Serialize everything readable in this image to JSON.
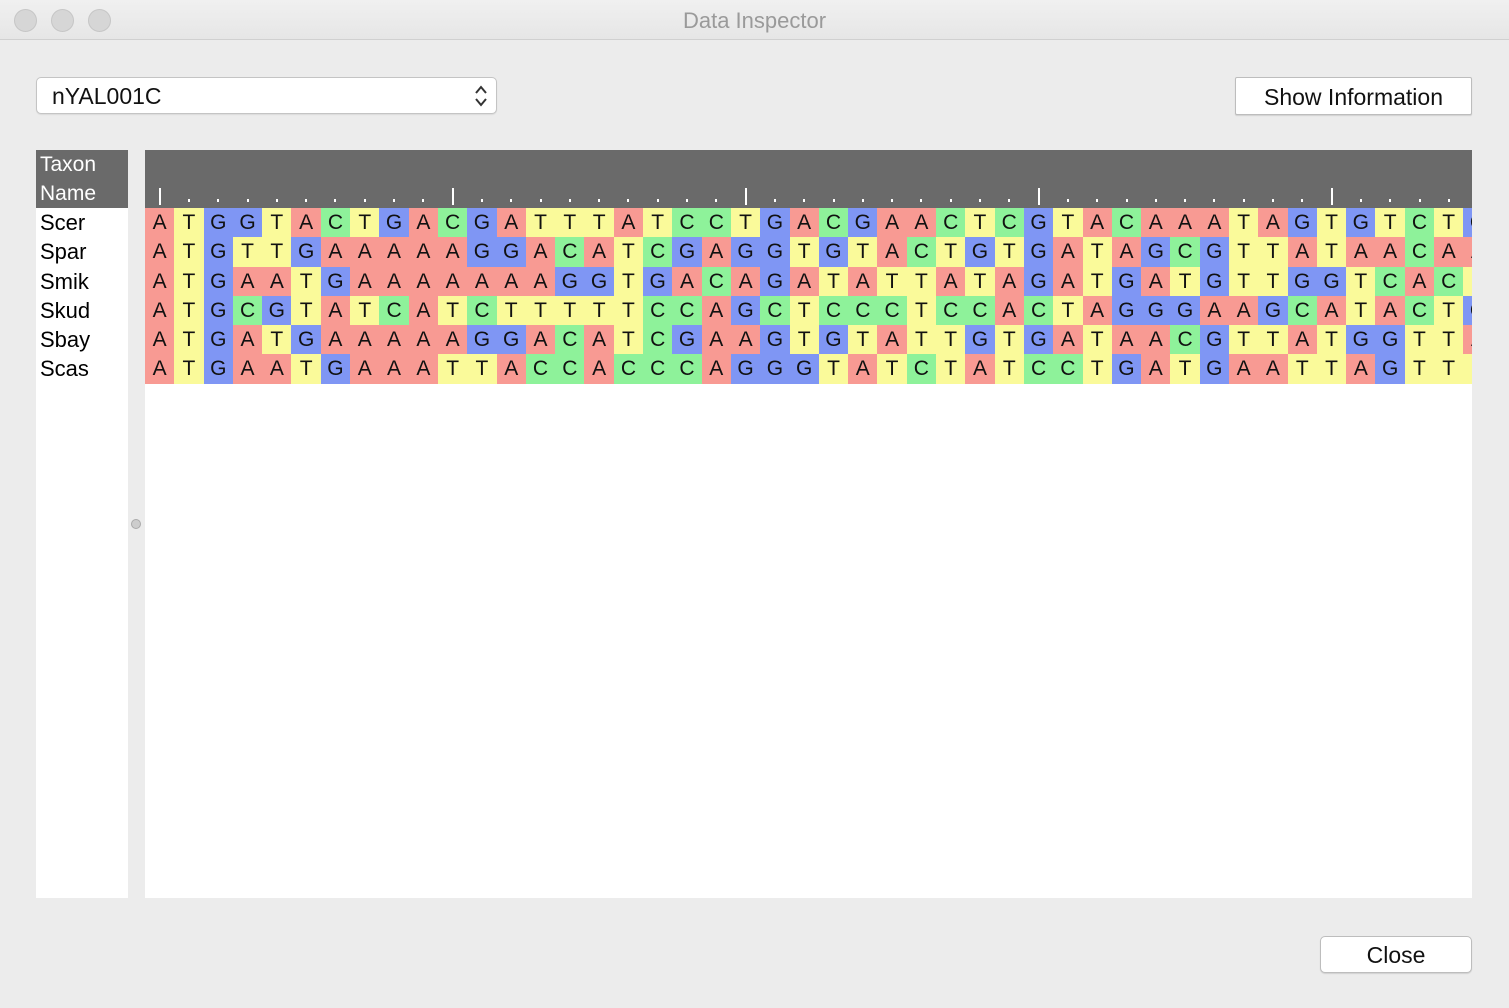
{
  "window": {
    "title": "Data Inspector"
  },
  "selector": {
    "value": "nYAL001C"
  },
  "buttons": {
    "show_info": "Show Information",
    "close": "Close"
  },
  "taxa_header": "Taxon Name",
  "taxa": [
    "Scer",
    "Spar",
    "Smik",
    "Skud",
    "Sbay",
    "Scas"
  ],
  "sequences": [
    "ATGGTACTGACGATTTATCCTGACGAACTCGTACAAATAGTGTCTG",
    "ATGTTGAAAAAGGACATCGAGGTGTACTGTGATAGCGTTATAACAA",
    "ATGAATGAAAAAAAGGTGACAGATATTATAGATGATGTTGGTCACT",
    "ATGCGTATCATCTTTTTCCAGCTCCCTCCACTAGGGAAGCATACTG",
    "ATGATGAAAAAGGACATCGAAGTGTATTGTGATAACGTTATGGTTA",
    "ATGAATGAAATTACCACCCAGGGTATCTATCCTGATGAATTAGTTT"
  ],
  "base_colors": {
    "A": "#f89a93",
    "T": "#fafa9a",
    "G": "#7f96f4",
    "C": "#8ef29a"
  }
}
